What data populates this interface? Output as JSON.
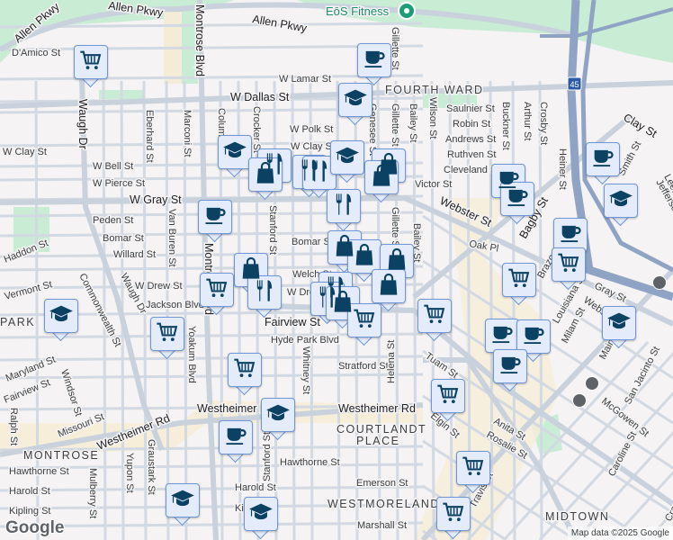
{
  "map": {
    "poi": "EōS Fitness",
    "neighborhoods": [
      "FOURTH WARD",
      "PARK",
      "MONTROSE",
      "COURTLANDT",
      "PLACE",
      "WESTMORELAND",
      "MIDTOWN"
    ],
    "streets": [
      "Allen Pkwy",
      "Allen Pkwy",
      "Allen Pkwy",
      "D'Amico St",
      "W Lamar St",
      "W Dallas St",
      "W Polk St",
      "W Clay St",
      "W Clay St",
      "W Bell St",
      "W Pierce St",
      "W Gray St",
      "Peden St",
      "Bomar St",
      "Bomar St",
      "Willard St",
      "Haddon St",
      "W Drew St",
      "Jackson Blvd",
      "Welch St",
      "W Drew St",
      "Fairview St",
      "Hyde Park Blvd",
      "Stratford St",
      "Westheimer Rd",
      "Westheimer Rd",
      "Westheimer Rd",
      "Hawthorne St",
      "Hawthorne St",
      "Harold St",
      "Harold St",
      "Kipling St",
      "Kipling St",
      "Emerson St",
      "Marshall St",
      "Waugh Dr",
      "Waugh Dr",
      "Eberhard St",
      "Marconi St",
      "Montrose Blvd",
      "Montrose Blvd",
      "Columbus St",
      "Crocker St",
      "Stanford St",
      "Stanford St",
      "Van Buren St",
      "Yoakum Blvd",
      "Commonwealth St",
      "Vermont St",
      "Maryland St",
      "Fairview St",
      "Windsor St",
      "Missouri St",
      "Ralph St",
      "Mulberry St",
      "Yupon St",
      "Graustark St",
      "Whitney St",
      "Gillette St",
      "Gillette St",
      "Gillette St",
      "Genesee St",
      "Bailey St",
      "Bailey St",
      "Wilson St",
      "Buckner St",
      "Arthur St",
      "Crosby St",
      "Saulnier St",
      "Robin St",
      "Andrews St",
      "Ruthven St",
      "Cleveland St",
      "Victor St",
      "Webster St",
      "Oak Pl",
      "Bagby St",
      "Heiner St",
      "Clay St",
      "Smith St",
      "Jefferson St",
      "Leeland St",
      "Brazos St",
      "Louisiana St",
      "Gray St",
      "Webster St",
      "Milam St",
      "Main St",
      "San Jacinto St",
      "McGowen St",
      "Caroline St",
      "Tuam St",
      "Elgin St",
      "Helena St",
      "Anita St",
      "Rosalie St",
      "Travis St",
      "Crawford St"
    ],
    "highway_shield": "45",
    "markers": [
      "cart",
      "coffee",
      "school",
      "school",
      "food",
      "bag",
      "food",
      "food",
      "school",
      "bag",
      "bag",
      "food",
      "coffee",
      "bag",
      "bag",
      "bag",
      "bag",
      "cart",
      "food",
      "food",
      "food",
      "bag",
      "bag",
      "cart",
      "cart",
      "cart",
      "school",
      "cart",
      "school",
      "coffee",
      "cart",
      "cart",
      "coffee",
      "coffee",
      "coffee",
      "school",
      "coffee",
      "school",
      "coffee",
      "coffee",
      "coffee",
      "cart",
      "cart",
      "cart",
      "school",
      "school"
    ]
  },
  "footer": {
    "logo": "Google",
    "attribution": "Map data ©2025 Google"
  },
  "colors": {
    "marker_fill": "#e4ecfc",
    "marker_border": "#6f96d6",
    "icon": "#0b4163",
    "highway": "#8fa4c4",
    "park": "#c8ecd4",
    "road": "#d2d9e2"
  }
}
